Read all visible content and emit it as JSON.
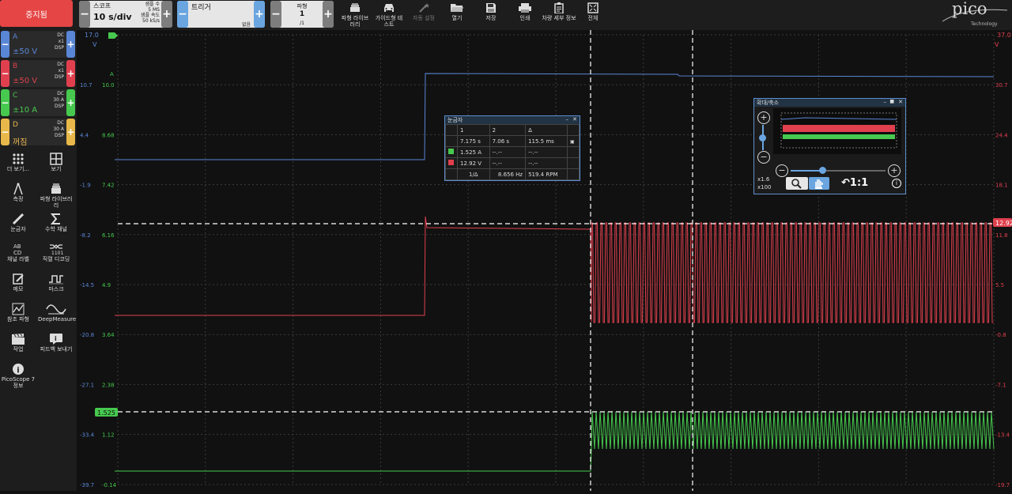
{
  "toolbar": {
    "stop_label": "중지됨",
    "scope_label": "스코프",
    "timebase": "10 s/div",
    "samples_label": "샘플 수",
    "samples_value": "5 MS",
    "rate_label": "샘플 속도",
    "rate_value": "50 kS/s",
    "trigger_label": "트리거",
    "trigger_mode": "없음",
    "waveform_label": "파형",
    "waveform_num": "1",
    "waveform_total": "/1",
    "tools": [
      {
        "label": "파형 라이브러리",
        "icon": "library-icon"
      },
      {
        "label": "가이드형 테스트",
        "icon": "car-icon"
      },
      {
        "label": "자동 설정",
        "icon": "wand-icon"
      },
      {
        "label": "열기",
        "icon": "folder-icon"
      },
      {
        "label": "저장",
        "icon": "save-icon"
      },
      {
        "label": "인쇄",
        "icon": "print-icon"
      },
      {
        "label": "차량 세부 정보",
        "icon": "clipboard-icon"
      },
      {
        "label": "전체",
        "icon": "fullscreen-icon"
      }
    ],
    "logo_text": "pico",
    "logo_sub": "Technology"
  },
  "channels": [
    {
      "letter": "A",
      "range": "±50 V",
      "coupling": "DC",
      "probe": "x1",
      "dsp": "DSP",
      "color": "#5a86d6"
    },
    {
      "letter": "B",
      "range": "±50 V",
      "coupling": "DC",
      "probe": "x1",
      "dsp": "DSP",
      "color": "#e0404e"
    },
    {
      "letter": "C",
      "range": "±10 A",
      "coupling": "DC",
      "probe": "30 A",
      "dsp": "DSP",
      "color": "#46c94e"
    },
    {
      "letter": "D",
      "range": "꺼짐",
      "coupling": "DC",
      "probe": "30 A",
      "dsp": "DSP",
      "color": "#e8b84a"
    }
  ],
  "sidebar_tools": [
    {
      "label": "더 보기...",
      "icon": "more-icon"
    },
    {
      "label": "보기",
      "icon": "grid-view-icon"
    },
    {
      "label": "측정",
      "icon": "caliper-icon"
    },
    {
      "label": "파형 라이브러리",
      "icon": "library-icon"
    },
    {
      "label": "눈금자",
      "icon": "ruler-icon"
    },
    {
      "label": "수학 채널",
      "icon": "sigma-icon"
    },
    {
      "label": "채널 라벨",
      "icon": "abcd-icon"
    },
    {
      "label": "직렬 디코딩",
      "icon": "decode-icon"
    },
    {
      "label": "메모",
      "icon": "note-icon"
    },
    {
      "label": "마스크",
      "icon": "mask-icon"
    },
    {
      "label": "참조 파형",
      "icon": "reference-icon"
    },
    {
      "label": "DeepMeasure",
      "icon": "deepmeasure-icon"
    },
    {
      "label": "작업",
      "icon": "clapper-icon"
    },
    {
      "label": "피드백 보내기",
      "icon": "feedback-icon"
    },
    {
      "label": "PicoScope 7 정보",
      "icon": "info-icon"
    }
  ],
  "axes": {
    "a_top": "17.0",
    "a_unit": "V",
    "b_top": "37.0",
    "b_unit": "V",
    "c_label": "A",
    "a_ticks": [
      "10.7",
      "4.4",
      "-1.9",
      "-8.2",
      "-14.5",
      "-20.8",
      "-27.1",
      "-33.4",
      "-39.7"
    ],
    "c_ticks": [
      "10.0",
      "8.68",
      "7.42",
      "6.16",
      "4.9",
      "3.64",
      "2.38",
      "1.12",
      "-0.14"
    ],
    "b_ticks": [
      "30.7",
      "24.4",
      "18.1",
      "11.8",
      "5.5",
      "-0.8",
      "-7.1",
      "-13.4",
      "-19.7"
    ],
    "b_marker": "12.92",
    "c_marker": "1.525"
  },
  "colors": {
    "channel_a": "#5a86d6",
    "channel_b": "#e0404e",
    "channel_c": "#46c94e",
    "accent": "#6aa5e0",
    "stop": "#e54545"
  },
  "rulers_panel": {
    "title": "눈금자",
    "col1": "1",
    "col2": "2",
    "col_delta": "Δ",
    "time1": "7.175 s",
    "time2": "7.06 s",
    "time_delta": "115.5 ms",
    "c_val": "1.525 A",
    "c_v2": "--.--",
    "c_d": "--.--",
    "b_val": "12.92 V",
    "b_v2": "--.--",
    "b_d": "--.--",
    "freq_label": "1/Δ",
    "freq": "8.656 Hz",
    "rpm": "519.4 RPM"
  },
  "zoom_panel": {
    "title": "확대/축소",
    "x_zoom": "x1.6",
    "y_zoom": "x100",
    "reset": "1:1"
  }
}
